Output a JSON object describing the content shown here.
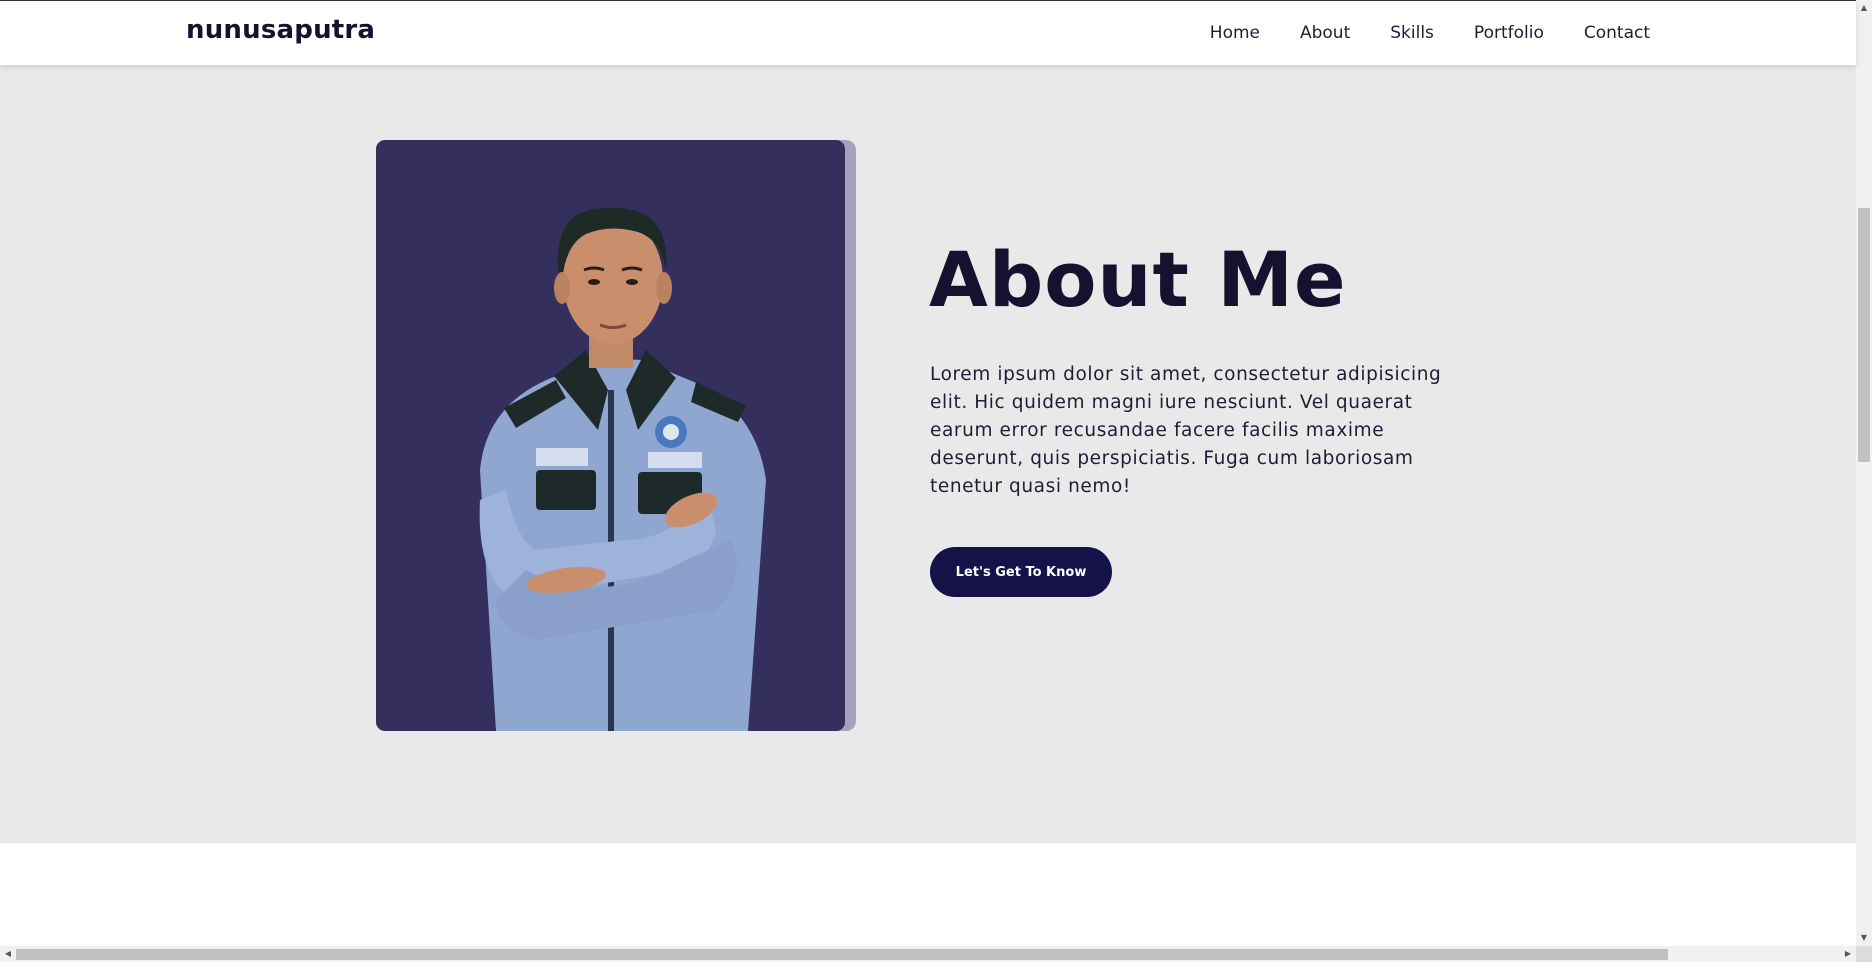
{
  "navbar": {
    "brand": "nunusaputra",
    "links": [
      "Home",
      "About",
      "Skills",
      "Portfolio",
      "Contact"
    ]
  },
  "about": {
    "title": "About Me",
    "description": "Lorem ipsum dolor sit amet, consectetur adipisicing elit. Hic quidem magni iure nesciunt. Vel quaerat earum error recusandae facere facilis maxime deserunt, quis perspiciatis. Fuga cum laboriosam tenetur quasi nemo!",
    "cta_label": "Let's Get To Know",
    "photo_alt": "portrait-photo"
  },
  "scrollbars": {
    "up_arrow": "▲",
    "down_arrow": "▼",
    "left_arrow": "◀",
    "right_arrow": "▶"
  },
  "colors": {
    "primary": "#15112e",
    "button": "#15124a",
    "photo_bg": "#352f5e",
    "photo_shadow": "#a7a2bb",
    "section_bg": "#e9e9e9"
  }
}
